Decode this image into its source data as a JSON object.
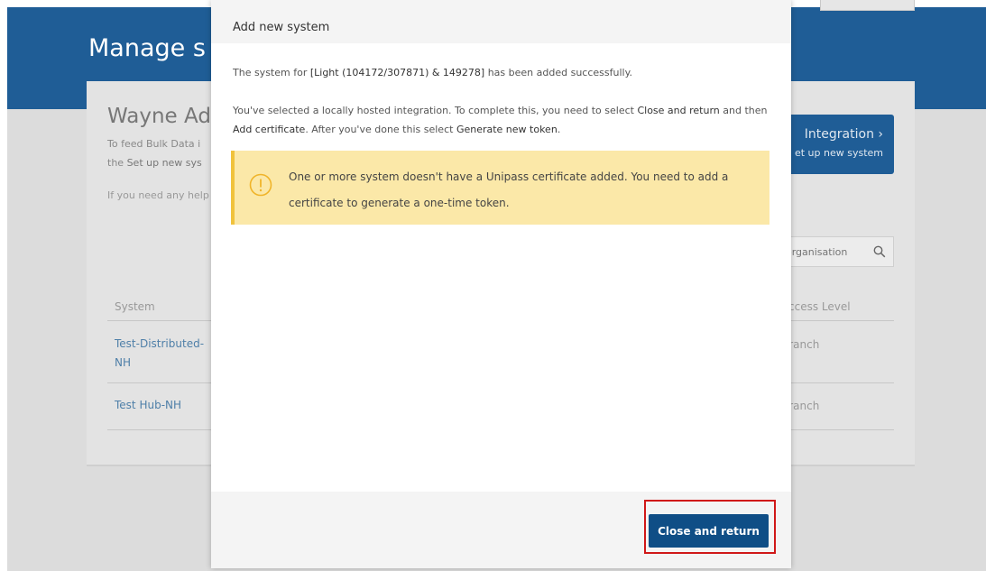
{
  "background": {
    "page_title": "Manage s",
    "org_name": "Wayne Adv",
    "desc_line1": "To feed Bulk Data i",
    "desc_line2_prefix": "the ",
    "desc_line2_bold": "Set up new sys",
    "help_text": "If you need any help",
    "integration_button": {
      "title": "Integration ›",
      "subtitle": "et up new system"
    },
    "search": {
      "placeholder": "organisation"
    },
    "table": {
      "columns": [
        "System",
        "Access Level"
      ],
      "rows": [
        {
          "name": "Test-Distributed-NH",
          "access": "Branch"
        },
        {
          "name": "Test Hub-NH",
          "access": "Branch"
        }
      ]
    }
  },
  "modal": {
    "title": "Add new system",
    "success_prefix": "The system for ",
    "success_strong": "[Light (104172/307871) & 149278]",
    "success_suffix": " has been added successfully.",
    "instruction_a": "You've selected a locally hosted integration. To complete this, you need to select ",
    "instruction_b": "Close and return",
    "instruction_c": " and then ",
    "instruction_d": "Add certificate",
    "instruction_e": ". After you've done this select ",
    "instruction_f": "Generate new token",
    "instruction_g": ".",
    "alert": {
      "icon": "warning-icon",
      "text": "One or more system doesn't have a Unipass certificate added. You need to add a certificate to generate a one-time token."
    },
    "close_button_label": "Close and return"
  },
  "colors": {
    "hero_blue": "#1f5d96",
    "button_blue": "#0f4e86",
    "alert_bg": "#fbe8a8",
    "alert_border": "#f0c23c",
    "highlight_red": "#d01818"
  }
}
